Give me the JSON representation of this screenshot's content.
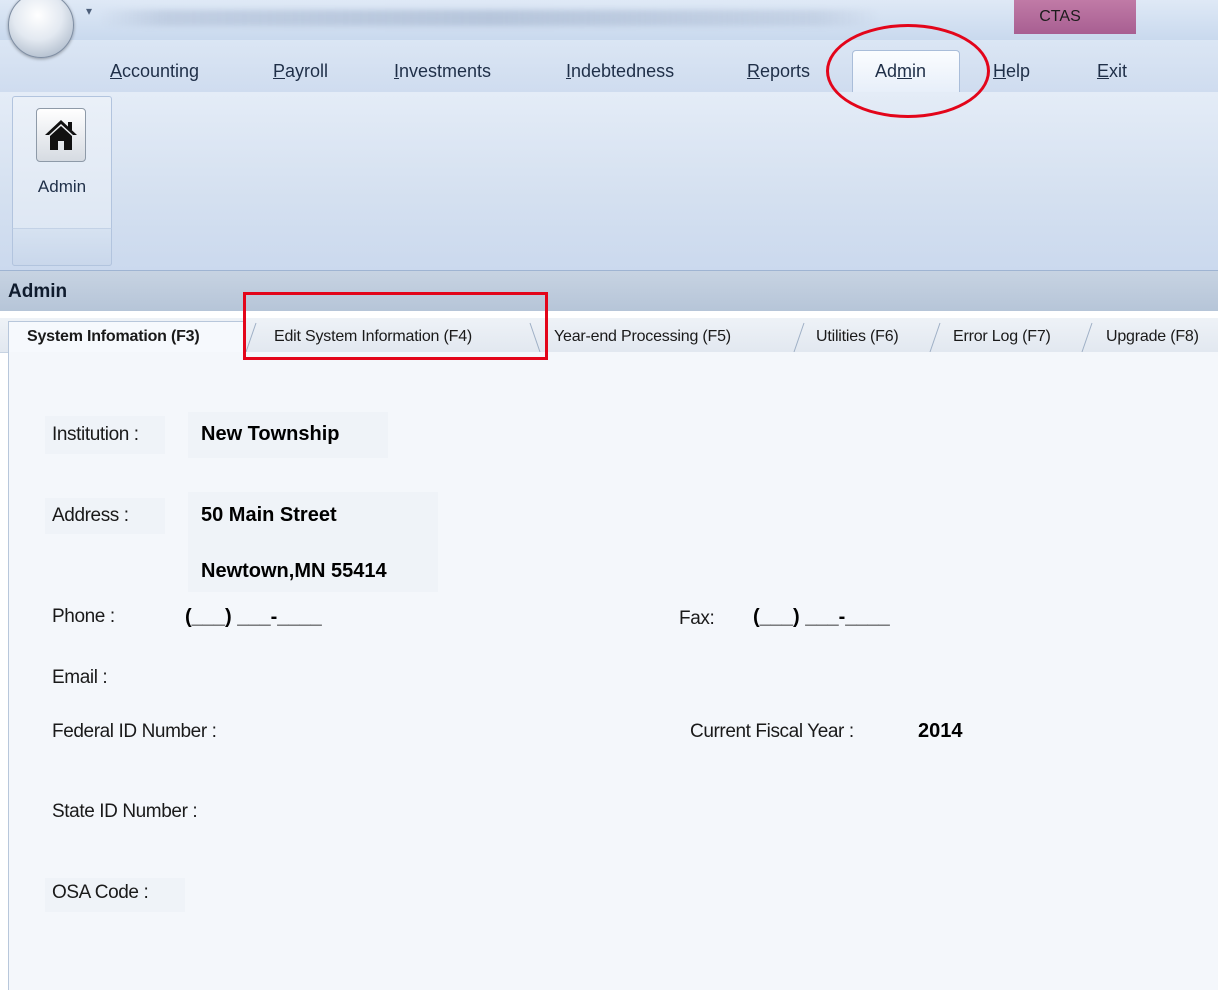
{
  "titlebar": {
    "quick_access_glyph": "▾",
    "app_name": "CTAS"
  },
  "menu": {
    "accounting": {
      "u": "A",
      "rest": "ccounting"
    },
    "payroll": {
      "u": "P",
      "rest": "ayroll"
    },
    "investments": {
      "u": "I",
      "rest": "nvestments"
    },
    "indebtedness": {
      "pre": "",
      "u": "I",
      "rest": "ndebtedness"
    },
    "reports": {
      "pre": "",
      "u": "R",
      "rest": "eports"
    },
    "admin": {
      "pre": "Ad",
      "u": "m",
      "rest": "in"
    },
    "help": {
      "u": "H",
      "rest": "elp"
    },
    "exit": {
      "u": "E",
      "rest": "xit"
    }
  },
  "ribbon": {
    "admin_button_label": "Admin",
    "icon": "home-icon"
  },
  "section": {
    "title": "Admin"
  },
  "subtabs": [
    {
      "label": "System Infomation (F3)",
      "active": true
    },
    {
      "label": "Edit System Information (F4)",
      "active": false
    },
    {
      "label": "Year-end Processing  (F5)",
      "active": false
    },
    {
      "label": "Utilities (F6)",
      "active": false
    },
    {
      "label": "Error Log (F7)",
      "active": false
    },
    {
      "label": "Upgrade (F8)",
      "active": false
    }
  ],
  "system_info": {
    "institution_label": "Institution :",
    "institution_value": "New Township",
    "address_label": "Address :",
    "address_line1": "50 Main Street",
    "address_line2": "Newtown,MN  55414",
    "phone_label": "Phone :",
    "phone_value": "(___) ___-____",
    "fax_label": "Fax:",
    "fax_value": "(___) ___-____",
    "email_label": "Email :",
    "federal_id_label": "Federal ID Number :",
    "fiscal_year_label": "Current Fiscal Year :",
    "fiscal_year_value": "2014",
    "state_id_label": "State ID Number :",
    "osa_code_label": "OSA Code :"
  },
  "colors": {
    "annotation": "#e3051a",
    "ctas_badge": "#b36a9c"
  }
}
